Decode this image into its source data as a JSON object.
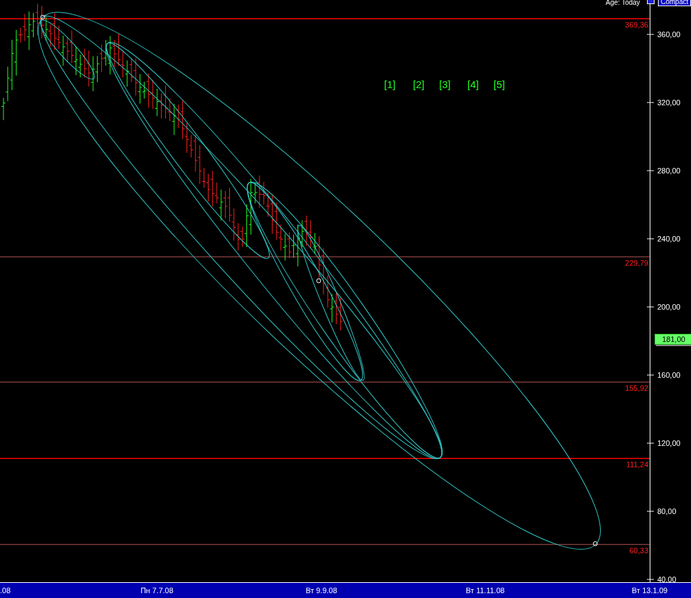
{
  "toolbar": {
    "age_label": "Age: Today",
    "compact_button": "Compact"
  },
  "chart": {
    "price_axis": [
      "360,00",
      "320,00",
      "280,00",
      "240,00",
      "200,00",
      "160,00",
      "120,00",
      "80,00",
      "40,00"
    ],
    "levels": [
      {
        "label": "369,36",
        "color": "#ff0000"
      },
      {
        "label": "229,79",
        "color": "#7a3a3a"
      },
      {
        "label": "155,92",
        "color": "#7a3a3a"
      },
      {
        "label": "111,24",
        "color": "#ff0000"
      },
      {
        "label": "60,33",
        "color": "#7a3a3a"
      }
    ],
    "current_price": "181,00",
    "wave_labels": [
      "[1]",
      "[2]",
      "[3]",
      "[4]",
      "[5]"
    ],
    "date_axis": [
      ".08",
      "Пн 7.7.08",
      "Вт 9.9.08",
      "Вт 11.11.08",
      "Вт 13.1.09"
    ]
  }
}
